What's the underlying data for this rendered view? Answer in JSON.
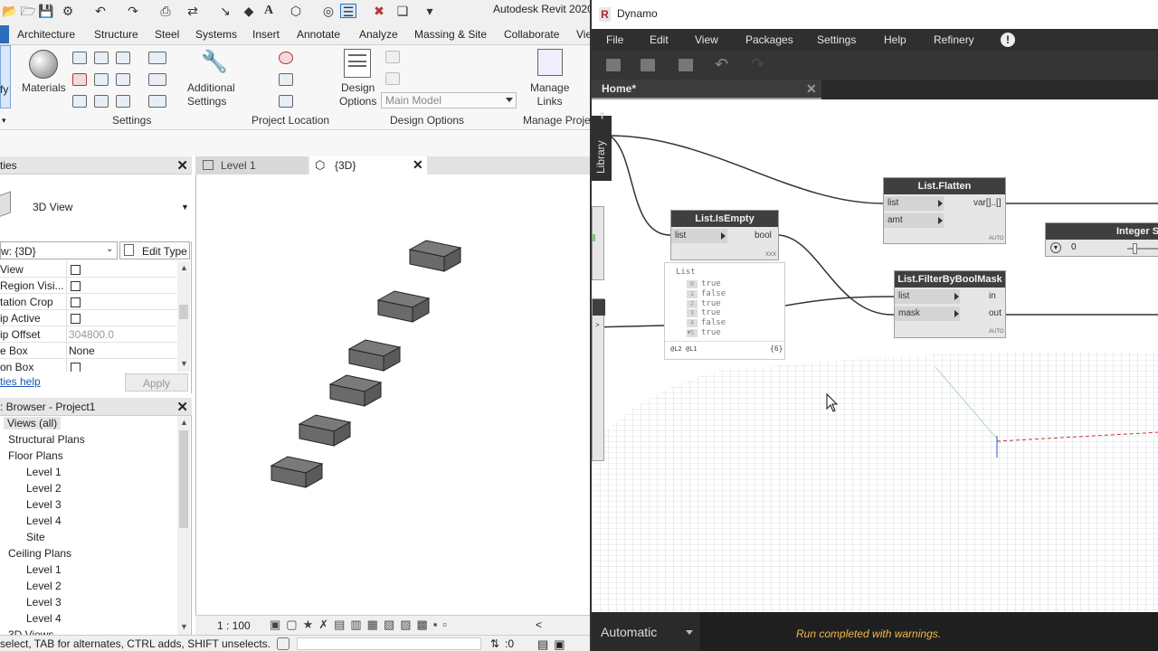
{
  "revit": {
    "title": "Autodesk Revit 2020",
    "tabs": [
      "Architecture",
      "Structure",
      "Steel",
      "Systems",
      "Insert",
      "Annotate",
      "Analyze",
      "Massing & Site",
      "Collaborate",
      "Vie"
    ],
    "modify_partial": "fy",
    "ribbon": {
      "materials": "Materials",
      "additional_settings": "Additional\nSettings",
      "design_options": "Design\nOptions",
      "main_model": "Main Model",
      "manage_links": "Manage\nLinks",
      "panels": {
        "settings": "Settings",
        "project_location": "Project Location",
        "design_options": "Design Options",
        "manage_project": "Manage Proje"
      }
    },
    "properties": {
      "title": "ties",
      "type_name": "3D View",
      "view_selector": "w: {3D}",
      "edit_type": "Edit Type",
      "rows": [
        {
          "label": "View",
          "value": "",
          "check": true
        },
        {
          "label": "Region Visi...",
          "value": "",
          "check": true
        },
        {
          "label": "tation Crop",
          "value": "",
          "check": true
        },
        {
          "label": "ip Active",
          "value": "",
          "check": true
        },
        {
          "label": "ip Offset",
          "value": "304800.0",
          "check": false,
          "gray": true
        },
        {
          "label": "e Box",
          "value": "None",
          "check": false
        },
        {
          "label": "on Box",
          "value": "",
          "check": true
        }
      ],
      "help_link": "ties help",
      "apply": "Apply"
    },
    "browser": {
      "title": ": Browser - Project1",
      "nodes": [
        {
          "label": "Views (all)",
          "indent": 0,
          "selected": true
        },
        {
          "label": "Structural Plans",
          "indent": 1
        },
        {
          "label": "Floor Plans",
          "indent": 1
        },
        {
          "label": "Level 1",
          "indent": 2
        },
        {
          "label": "Level 2",
          "indent": 2
        },
        {
          "label": "Level 3",
          "indent": 2
        },
        {
          "label": "Level 4",
          "indent": 2
        },
        {
          "label": "Site",
          "indent": 2
        },
        {
          "label": "Ceiling Plans",
          "indent": 1
        },
        {
          "label": "Level 1",
          "indent": 2
        },
        {
          "label": "Level 2",
          "indent": 2
        },
        {
          "label": "Level 3",
          "indent": 2
        },
        {
          "label": "Level 4",
          "indent": 2
        },
        {
          "label": "3D Views",
          "indent": 1
        }
      ]
    },
    "view_tabs": {
      "level1": "Level 1",
      "threed": "{3D}"
    },
    "view_scale": "1 : 100",
    "status_text": "select, TAB for alternates, CTRL adds, SHIFT unselects.",
    "status_count": ":0"
  },
  "dynamo": {
    "title": "Dynamo",
    "logo": "R",
    "menu": [
      "File",
      "Edit",
      "View",
      "Packages",
      "Settings",
      "Help",
      "Refinery"
    ],
    "warning_icon": "!",
    "tab": "Home*",
    "library": "Library",
    "nodes": {
      "flatten": {
        "title": "List.Flatten",
        "in": [
          "list",
          "amt"
        ],
        "out": "var[]..[]",
        "footer": "AUTO"
      },
      "isempty": {
        "title": "List.IsEmpty",
        "in": [
          "list"
        ],
        "out": "bool",
        "footer": "XXX"
      },
      "filter": {
        "title": "List.FilterByBoolMask",
        "in": [
          "list",
          "mask"
        ],
        "out": [
          "in",
          "out"
        ],
        "footer": "AUTO"
      },
      "slider": {
        "title": "Integer Sli",
        "value": "0"
      }
    },
    "watch": {
      "header": "List",
      "items": [
        {
          "index": "0",
          "value": "true"
        },
        {
          "index": "1",
          "value": "false"
        },
        {
          "index": "2",
          "value": "true"
        },
        {
          "index": "3",
          "value": "true"
        },
        {
          "index": "4",
          "value": "false"
        },
        {
          "index": "5",
          "value": "true"
        }
      ],
      "levels": "@L2 @L1",
      "count": "{6}"
    },
    "run_mode": "Automatic",
    "run_status": "Run completed with warnings."
  }
}
